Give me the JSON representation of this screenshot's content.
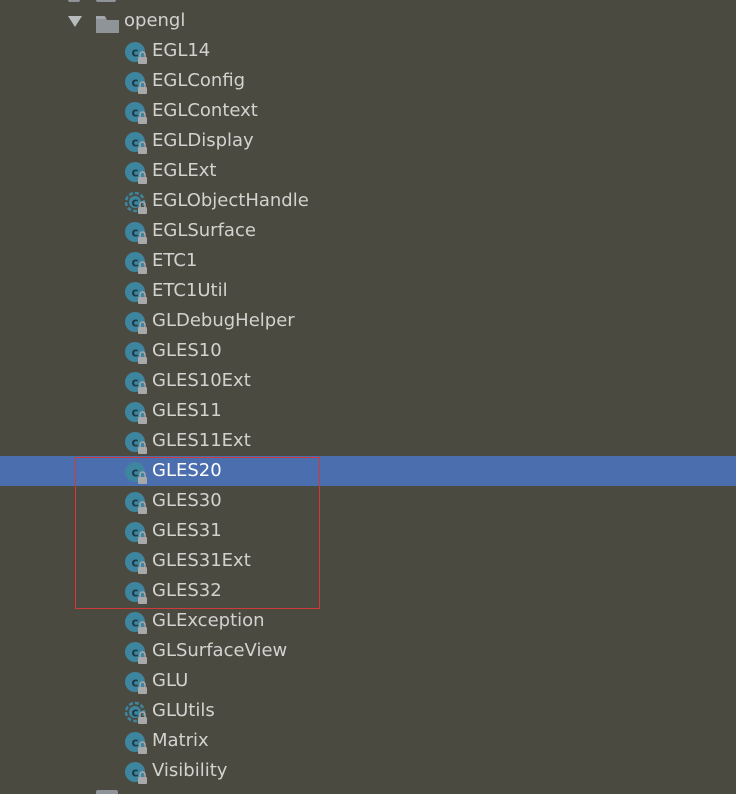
{
  "tree": {
    "folder": {
      "label": "opengl",
      "expanded": true
    },
    "items": [
      {
        "label": "EGL14",
        "icon": "class-icon"
      },
      {
        "label": "EGLConfig",
        "icon": "class-icon"
      },
      {
        "label": "EGLContext",
        "icon": "class-icon"
      },
      {
        "label": "EGLDisplay",
        "icon": "class-icon"
      },
      {
        "label": "EGLExt",
        "icon": "class-icon"
      },
      {
        "label": "EGLObjectHandle",
        "icon": "abstract-class-icon"
      },
      {
        "label": "EGLSurface",
        "icon": "class-icon"
      },
      {
        "label": "ETC1",
        "icon": "class-icon"
      },
      {
        "label": "ETC1Util",
        "icon": "class-icon"
      },
      {
        "label": "GLDebugHelper",
        "icon": "class-icon"
      },
      {
        "label": "GLES10",
        "icon": "class-icon"
      },
      {
        "label": "GLES10Ext",
        "icon": "class-icon"
      },
      {
        "label": "GLES11",
        "icon": "class-icon"
      },
      {
        "label": "GLES11Ext",
        "icon": "class-icon"
      },
      {
        "label": "GLES20",
        "icon": "class-icon",
        "selected": true
      },
      {
        "label": "GLES30",
        "icon": "class-icon"
      },
      {
        "label": "GLES31",
        "icon": "class-icon"
      },
      {
        "label": "GLES31Ext",
        "icon": "class-icon"
      },
      {
        "label": "GLES32",
        "icon": "class-icon"
      },
      {
        "label": "GLException",
        "icon": "class-icon"
      },
      {
        "label": "GLSurfaceView",
        "icon": "class-icon"
      },
      {
        "label": "GLU",
        "icon": "class-icon"
      },
      {
        "label": "GLUtils",
        "icon": "abstract-class-icon"
      },
      {
        "label": "Matrix",
        "icon": "class-icon"
      },
      {
        "label": "Visibility",
        "icon": "class-icon"
      }
    ]
  },
  "colors": {
    "background": "#4b4a40",
    "text": "#d2d2cf",
    "selection": "#4b6eaf",
    "selected_text": "#ffffff",
    "class_icon": "#3e86a0",
    "lock_overlay": "#a7a9ab",
    "highlight_border": "#d23939",
    "folder_icon": "#8f9499"
  }
}
